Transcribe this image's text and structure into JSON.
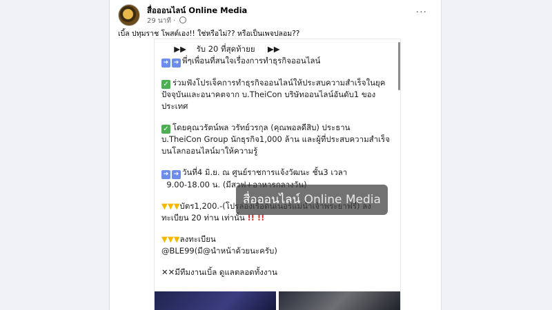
{
  "post": {
    "page_name": "สื่อออนไลน์ Online Media",
    "time": "29 นาที",
    "dot": "·",
    "more": "···",
    "caption": "เบิ้ล ปทุมราช โพสต์เอง!! ใช่หรือไม่?? หรือเป็นเพจปลอม??"
  },
  "image_text": {
    "line1": "รับ 20 ที่สุดท้ายย",
    "line2": "พี่ๆเพื่อนที่สนใจเรื่องการทำธุรกิจออนไลน์",
    "line3": "ร่วมฟังโปรเจ็คการทำธุรกิจออนไลน์ให้ประสบความสำเร็จในยุค",
    "line4": "ปัจจุบันและอนาคตจาก บ.TheiCon บริษัทออนไลน์อันดับ1 ของ",
    "line5": "ประเทศ",
    "line6": "โดยคุณวรัตน์พล วรัทย์วรกุล (คุณพอลดีสิบ) ประธาน",
    "line7": "บ.TheiCon Group นักธุรกิจ1,000 ล้าน และผู้ที่ประสบความสำเร็จ",
    "line8": "บนโลกออนไลน์มาให้ความรู้",
    "line9": "วันที่4 มิ.ย. ณ ศูนย์ราชการแจ้งวัฒนะ ชั้น3 เวลา",
    "line10": "9.00-18.00 น. (มีสวฟ+อาหารกลางวัน)",
    "line11": "บัตร1,200.-(โปรล่องเรือดินเนอร์แม่น้ำเจ้าพระยาฟรี) ลง",
    "line12": "ทะเบียน 20 ท่าน เท่านั้น",
    "line12_bang": "!! !!",
    "line13": "ลงทะเบียน",
    "line14": "@BLE99(มี@นำหน้าด้วยนะครับ)",
    "line15": "มีทีมงานเบิ้ล ดูแลตลอดทั้งงาน"
  },
  "watermark": {
    "thai": "สื่อออนไลน์",
    "english": "Online Media"
  },
  "icons": {
    "megaphone": "📢",
    "arrow": "➡",
    "check": "✔",
    "hand": "👇",
    "tools": "⚒"
  }
}
